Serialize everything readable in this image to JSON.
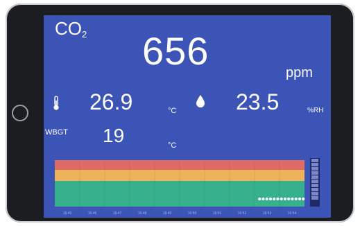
{
  "co2": {
    "label": "CO",
    "sub": "2",
    "value": "656",
    "unit": "ppm"
  },
  "temperature": {
    "icon": "thermometer-icon",
    "value": "26.9",
    "unit": "°C"
  },
  "humidity": {
    "icon": "water-drop-icon",
    "value": "23.5",
    "unit": "%RH"
  },
  "wbgt": {
    "label": "WBGT",
    "value": "19",
    "unit": "°C"
  },
  "colors": {
    "screen": "#3c54b5",
    "band_red": "#e06a66",
    "band_orange": "#eeb15c",
    "band_green": "#37b08e",
    "points": "#ffffff"
  },
  "chart_data": {
    "type": "scatter",
    "x": [
      "16:45",
      "16:46",
      "16:47",
      "16:48",
      "16:49",
      "16:50",
      "16:51",
      "16:52",
      "16:53",
      "16:54"
    ],
    "points": [
      {
        "x": "16:53",
        "y": 656
      },
      {
        "x": "16:53",
        "y": 656
      },
      {
        "x": "16:53",
        "y": 656
      },
      {
        "x": "16:53",
        "y": 656
      },
      {
        "x": "16:53",
        "y": 656
      },
      {
        "x": "16:54",
        "y": 656
      },
      {
        "x": "16:54",
        "y": 656
      },
      {
        "x": "16:54",
        "y": 656
      },
      {
        "x": "16:54",
        "y": 656
      },
      {
        "x": "16:54",
        "y": 656
      },
      {
        "x": "16:54",
        "y": 656
      },
      {
        "x": "16:54",
        "y": 656
      },
      {
        "x": "16:54",
        "y": 656
      }
    ],
    "bands": [
      {
        "name": "red",
        "from": 1500,
        "to": 2000,
        "color": "#e06a66"
      },
      {
        "name": "orange",
        "from": 1000,
        "to": 1500,
        "color": "#eeb15c"
      },
      {
        "name": "green",
        "from": 0,
        "to": 1000,
        "color": "#37b08e"
      }
    ],
    "ylim": [
      0,
      2000
    ],
    "grid": true
  }
}
